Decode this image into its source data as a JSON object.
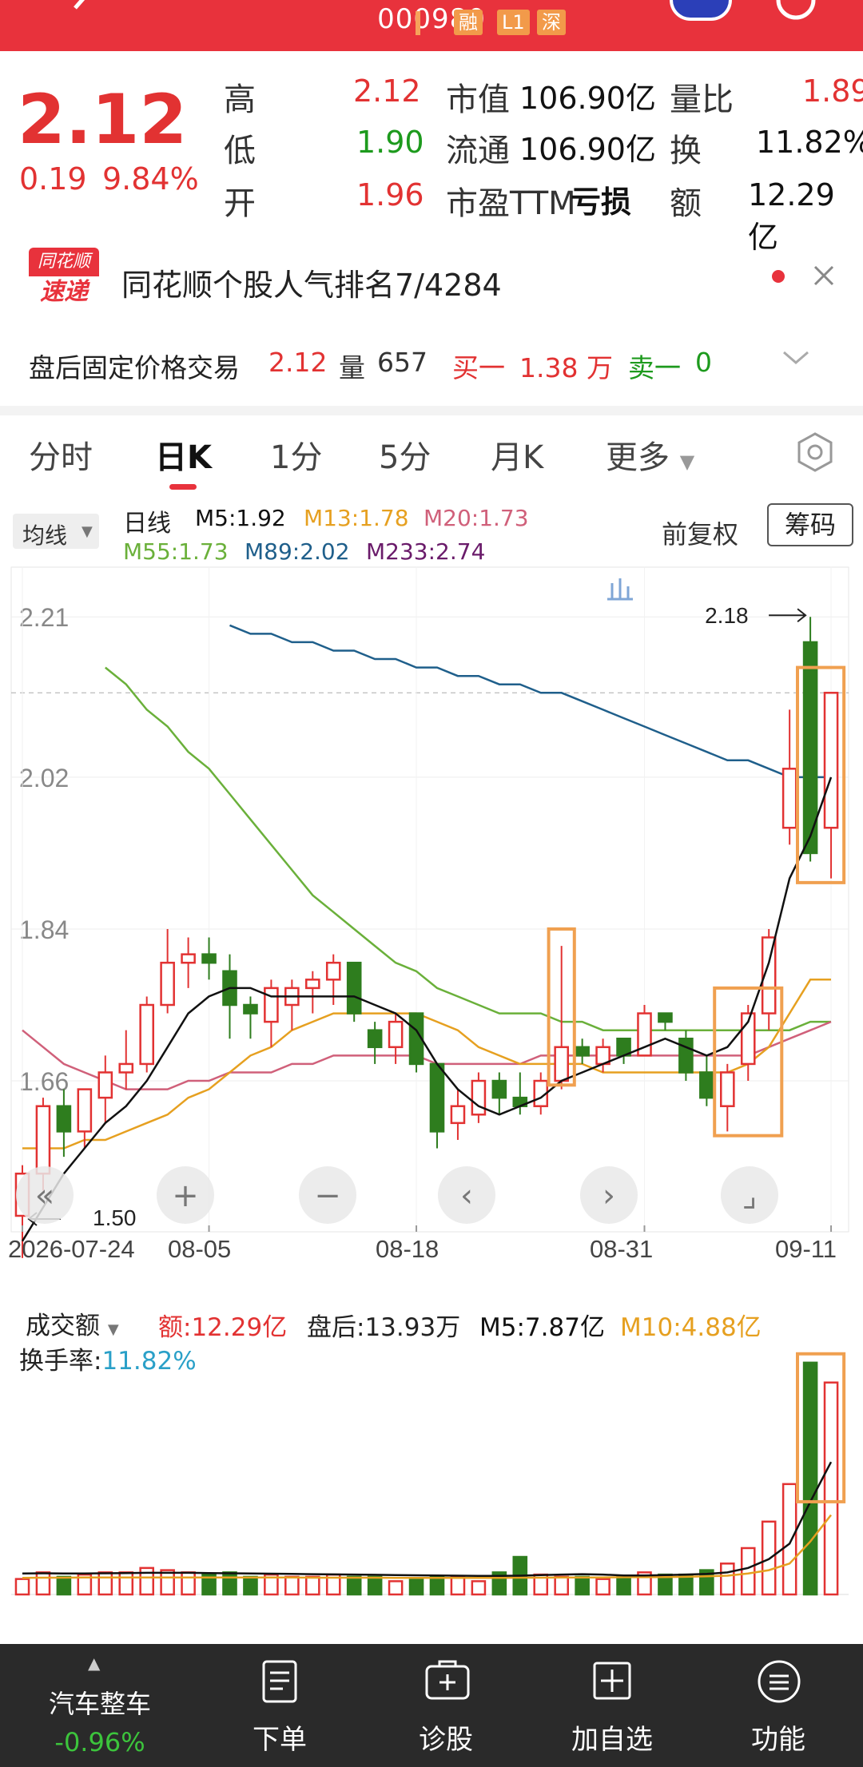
{
  "header": {
    "code": "000980",
    "tags": [
      "融",
      "L1",
      "深"
    ]
  },
  "quote": {
    "price": "2.12",
    "change": "0.19",
    "change_pct": "9.84%",
    "high_label": "高",
    "high": "2.12",
    "low_label": "低",
    "low": "1.90",
    "open_label": "开",
    "open": "1.96",
    "mcap_label": "市值",
    "mcap": "106.90亿",
    "float_label": "流通",
    "float": "106.90亿",
    "pe_label": "市盈TTM",
    "pe": "亏损",
    "vol_ratio_label": "量比",
    "vol_ratio": "1.89",
    "turnover_label": "换",
    "turnover": "11.82%",
    "amount_label": "额",
    "amount": "12.29亿"
  },
  "banner": {
    "logo_top": "同花顺",
    "logo_bottom": "速递",
    "text": "同花顺个股人气排名7/4284"
  },
  "after_hours": {
    "label": "盘后固定价格交易",
    "price": "2.12",
    "vol_label": "量",
    "vol": "657",
    "buy_label": "买一",
    "buy": "1.38 万",
    "sell_label": "卖一",
    "sell": "0"
  },
  "tabs": [
    "分时",
    "日K",
    "1分",
    "5分",
    "月K",
    "更多"
  ],
  "active_tab": "日K",
  "indicators": {
    "selector": "均线",
    "kline_label": "日线",
    "m5": "M5:1.92",
    "m13": "M13:1.78",
    "m20": "M20:1.73",
    "m55": "M55:1.73",
    "m89": "M89:2.02",
    "m233": "M233:2.74",
    "adjust": "前复权",
    "chip_button": "筹码"
  },
  "colors": {
    "up": "#e23232",
    "down": "#2e7d1e",
    "m5": "#111111",
    "m13": "#e6a020",
    "m20": "#d0607a",
    "m55": "#6ab03a",
    "m89": "#1f5f8b",
    "m233": "#6a1b6a",
    "highlight": "#f0a050"
  },
  "chart_data": {
    "type": "candlestick",
    "y_ticks": [
      "2.21",
      "2.02",
      "1.84",
      "1.66"
    ],
    "x_ticks": [
      "2026-07-24",
      "08-05",
      "08-18",
      "08-31",
      "09-11"
    ],
    "high_label": "2.18",
    "low_label": "1.50",
    "ylim": [
      1.5,
      2.25
    ],
    "candles": [
      {
        "o": 1.5,
        "h": 1.56,
        "l": 1.45,
        "c": 1.55
      },
      {
        "o": 1.55,
        "h": 1.64,
        "l": 1.53,
        "c": 1.63
      },
      {
        "o": 1.63,
        "h": 1.65,
        "l": 1.57,
        "c": 1.6
      },
      {
        "o": 1.6,
        "h": 1.65,
        "l": 1.58,
        "c": 1.65
      },
      {
        "o": 1.64,
        "h": 1.69,
        "l": 1.61,
        "c": 1.67
      },
      {
        "o": 1.67,
        "h": 1.72,
        "l": 1.65,
        "c": 1.68
      },
      {
        "o": 1.68,
        "h": 1.76,
        "l": 1.67,
        "c": 1.75
      },
      {
        "o": 1.75,
        "h": 1.84,
        "l": 1.74,
        "c": 1.8
      },
      {
        "o": 1.8,
        "h": 1.83,
        "l": 1.77,
        "c": 1.81
      },
      {
        "o": 1.81,
        "h": 1.83,
        "l": 1.78,
        "c": 1.8
      },
      {
        "o": 1.79,
        "h": 1.81,
        "l": 1.71,
        "c": 1.75
      },
      {
        "o": 1.75,
        "h": 1.76,
        "l": 1.71,
        "c": 1.74
      },
      {
        "o": 1.73,
        "h": 1.78,
        "l": 1.7,
        "c": 1.77
      },
      {
        "o": 1.75,
        "h": 1.78,
        "l": 1.72,
        "c": 1.77
      },
      {
        "o": 1.77,
        "h": 1.79,
        "l": 1.74,
        "c": 1.78
      },
      {
        "o": 1.78,
        "h": 1.81,
        "l": 1.75,
        "c": 1.8
      },
      {
        "o": 1.8,
        "h": 1.8,
        "l": 1.73,
        "c": 1.74
      },
      {
        "o": 1.72,
        "h": 1.73,
        "l": 1.68,
        "c": 1.7
      },
      {
        "o": 1.7,
        "h": 1.74,
        "l": 1.68,
        "c": 1.73
      },
      {
        "o": 1.74,
        "h": 1.74,
        "l": 1.67,
        "c": 1.68
      },
      {
        "o": 1.68,
        "h": 1.68,
        "l": 1.58,
        "c": 1.6
      },
      {
        "o": 1.61,
        "h": 1.65,
        "l": 1.59,
        "c": 1.63
      },
      {
        "o": 1.62,
        "h": 1.67,
        "l": 1.61,
        "c": 1.66
      },
      {
        "o": 1.66,
        "h": 1.67,
        "l": 1.62,
        "c": 1.64
      },
      {
        "o": 1.64,
        "h": 1.67,
        "l": 1.62,
        "c": 1.63
      },
      {
        "o": 1.63,
        "h": 1.67,
        "l": 1.62,
        "c": 1.66
      },
      {
        "o": 1.66,
        "h": 1.82,
        "l": 1.65,
        "c": 1.7
      },
      {
        "o": 1.7,
        "h": 1.71,
        "l": 1.68,
        "c": 1.69
      },
      {
        "o": 1.68,
        "h": 1.71,
        "l": 1.67,
        "c": 1.7
      },
      {
        "o": 1.71,
        "h": 1.71,
        "l": 1.68,
        "c": 1.69
      },
      {
        "o": 1.69,
        "h": 1.75,
        "l": 1.69,
        "c": 1.74
      },
      {
        "o": 1.74,
        "h": 1.74,
        "l": 1.72,
        "c": 1.73
      },
      {
        "o": 1.71,
        "h": 1.72,
        "l": 1.66,
        "c": 1.67
      },
      {
        "o": 1.67,
        "h": 1.69,
        "l": 1.63,
        "c": 1.64
      },
      {
        "o": 1.63,
        "h": 1.68,
        "l": 1.6,
        "c": 1.67
      },
      {
        "o": 1.68,
        "h": 1.75,
        "l": 1.66,
        "c": 1.74
      },
      {
        "o": 1.74,
        "h": 1.84,
        "l": 1.72,
        "c": 1.83
      },
      {
        "o": 1.96,
        "h": 2.1,
        "l": 1.94,
        "c": 2.03
      },
      {
        "o": 2.18,
        "h": 2.21,
        "l": 1.92,
        "c": 1.93
      },
      {
        "o": 1.96,
        "h": 2.12,
        "l": 1.9,
        "c": 2.12
      }
    ],
    "ma": {
      "M5": [
        1.47,
        1.51,
        1.55,
        1.58,
        1.61,
        1.63,
        1.66,
        1.7,
        1.74,
        1.76,
        1.77,
        1.77,
        1.76,
        1.76,
        1.76,
        1.76,
        1.76,
        1.75,
        1.74,
        1.72,
        1.68,
        1.65,
        1.63,
        1.62,
        1.63,
        1.64,
        1.66,
        1.67,
        1.68,
        1.69,
        1.7,
        1.71,
        1.7,
        1.69,
        1.7,
        1.73,
        1.8,
        1.9,
        1.95,
        2.02
      ],
      "M13": [
        1.58,
        1.58,
        1.58,
        1.59,
        1.59,
        1.6,
        1.61,
        1.62,
        1.64,
        1.65,
        1.67,
        1.69,
        1.7,
        1.72,
        1.73,
        1.74,
        1.74,
        1.74,
        1.74,
        1.74,
        1.73,
        1.72,
        1.7,
        1.69,
        1.68,
        1.68,
        1.68,
        1.68,
        1.67,
        1.67,
        1.67,
        1.67,
        1.67,
        1.67,
        1.67,
        1.68,
        1.7,
        1.74,
        1.78,
        1.78
      ],
      "M20": [
        1.72,
        1.7,
        1.68,
        1.67,
        1.66,
        1.65,
        1.65,
        1.65,
        1.66,
        1.66,
        1.67,
        1.67,
        1.67,
        1.68,
        1.68,
        1.69,
        1.69,
        1.69,
        1.69,
        1.69,
        1.68,
        1.68,
        1.68,
        1.68,
        1.68,
        1.69,
        1.69,
        1.69,
        1.69,
        1.69,
        1.69,
        1.69,
        1.69,
        1.69,
        1.69,
        1.69,
        1.7,
        1.71,
        1.72,
        1.73
      ],
      "M55": [
        null,
        null,
        null,
        null,
        2.15,
        2.13,
        2.1,
        2.08,
        2.05,
        2.03,
        2.0,
        1.97,
        1.94,
        1.91,
        1.88,
        1.86,
        1.84,
        1.82,
        1.8,
        1.79,
        1.77,
        1.76,
        1.75,
        1.74,
        1.74,
        1.74,
        1.73,
        1.73,
        1.72,
        1.72,
        1.72,
        1.72,
        1.72,
        1.72,
        1.72,
        1.72,
        1.72,
        1.72,
        1.73,
        1.73
      ],
      "M89": [
        null,
        null,
        null,
        null,
        null,
        null,
        null,
        null,
        null,
        null,
        2.2,
        2.19,
        2.19,
        2.18,
        2.18,
        2.17,
        2.17,
        2.16,
        2.16,
        2.15,
        2.15,
        2.14,
        2.14,
        2.13,
        2.13,
        2.12,
        2.12,
        2.11,
        2.1,
        2.09,
        2.08,
        2.07,
        2.06,
        2.05,
        2.04,
        2.04,
        2.03,
        2.02,
        2.02,
        2.02
      ]
    },
    "volume": {
      "label": "成交额",
      "amount": "额:12.29亿",
      "after_hours": "盘后:13.93万",
      "m5": "M5:7.87亿",
      "m10": "M10:4.88亿",
      "turnover_label": "换手率:",
      "turnover": "11.82%",
      "values": [
        0.7,
        1.0,
        0.8,
        0.9,
        1.0,
        1.0,
        1.2,
        1.1,
        1.0,
        0.9,
        1.0,
        0.8,
        0.9,
        0.8,
        0.8,
        0.9,
        0.8,
        0.8,
        0.6,
        0.7,
        0.8,
        0.8,
        0.6,
        1.0,
        1.7,
        0.9,
        0.8,
        0.8,
        0.7,
        0.8,
        1.0,
        0.9,
        0.9,
        1.1,
        1.4,
        2.1,
        3.3,
        5.0,
        10.5,
        9.6
      ],
      "vm5": [
        0.95,
        0.96,
        0.95,
        0.95,
        0.96,
        0.97,
        0.98,
        0.98,
        0.98,
        0.97,
        0.96,
        0.95,
        0.94,
        0.93,
        0.92,
        0.91,
        0.9,
        0.89,
        0.88,
        0.87,
        0.86,
        0.85,
        0.84,
        0.84,
        0.85,
        0.88,
        0.9,
        0.92,
        0.9,
        0.86,
        0.86,
        0.88,
        0.9,
        0.93,
        1.0,
        1.2,
        1.6,
        2.3,
        4.2,
        6.0
      ],
      "vm10": [
        0.75,
        0.76,
        0.76,
        0.77,
        0.77,
        0.77,
        0.77,
        0.77,
        0.77,
        0.77,
        0.77,
        0.77,
        0.77,
        0.77,
        0.76,
        0.76,
        0.76,
        0.76,
        0.75,
        0.75,
        0.75,
        0.75,
        0.75,
        0.75,
        0.76,
        0.76,
        0.77,
        0.77,
        0.77,
        0.78,
        0.78,
        0.79,
        0.8,
        0.82,
        0.85,
        0.95,
        1.1,
        1.4,
        2.4,
        3.6
      ]
    }
  },
  "chart_controls": [
    "«",
    "+",
    "−",
    "‹",
    "›",
    "⌟"
  ],
  "footer": {
    "sector_name": "汽车整车",
    "sector_change": "-0.96%",
    "buttons": [
      "下单",
      "诊股",
      "加自选",
      "功能"
    ]
  }
}
